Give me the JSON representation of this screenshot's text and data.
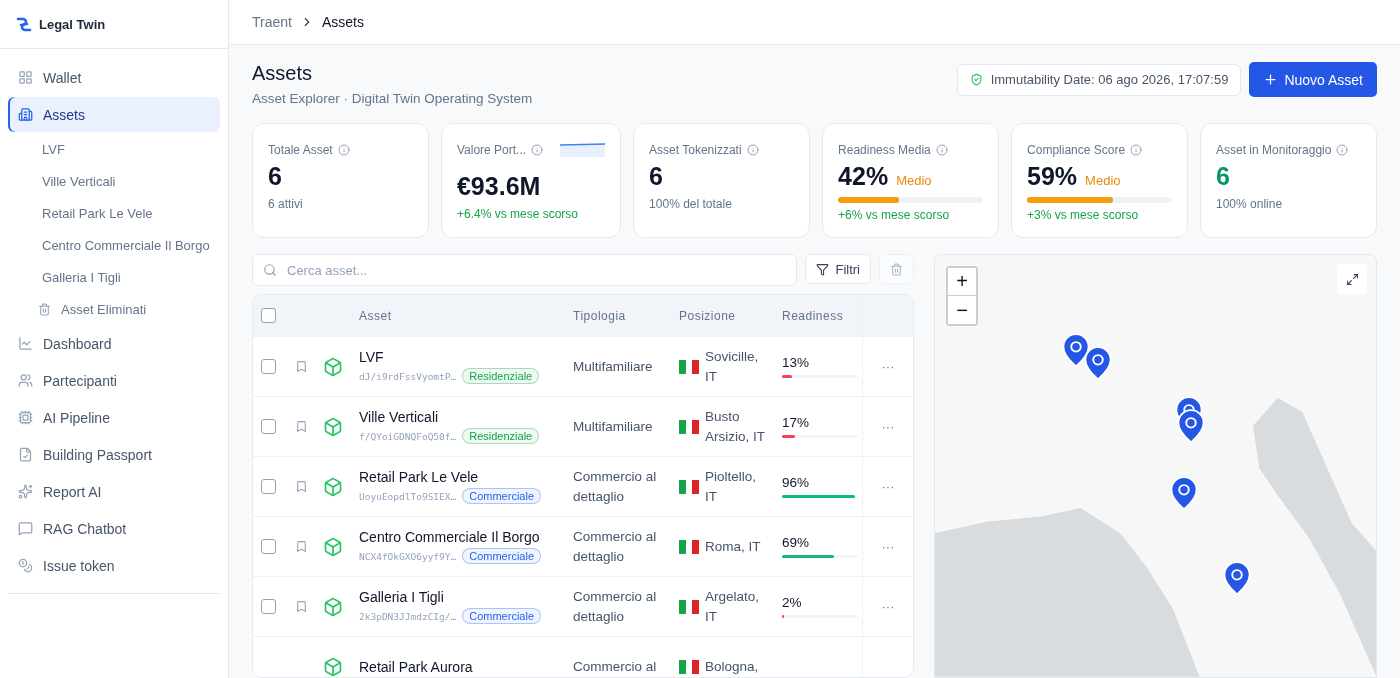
{
  "brand": {
    "name": "Legal Twin"
  },
  "sidebar": {
    "items": [
      {
        "kind": "nav",
        "label": "Wallet",
        "selected": false
      },
      {
        "kind": "nav",
        "label": "Assets",
        "selected": true
      },
      {
        "kind": "sub",
        "label": "LVF",
        "selected": false
      },
      {
        "kind": "sub",
        "label": "Ville Verticali",
        "selected": false
      },
      {
        "kind": "sub",
        "label": "Retail Park Le Vele",
        "selected": false
      },
      {
        "kind": "sub",
        "label": "Centro Commerciale Il Borgo",
        "selected": false
      },
      {
        "kind": "sub",
        "label": "Galleria I Tigli",
        "selected": false
      },
      {
        "kind": "trash",
        "label": "Asset Eliminati",
        "selected": false
      },
      {
        "kind": "nav",
        "label": "Dashboard",
        "selected": false
      },
      {
        "kind": "nav",
        "label": "Partecipanti",
        "selected": false
      },
      {
        "kind": "nav",
        "label": "AI Pipeline",
        "selected": false
      },
      {
        "kind": "nav",
        "label": "Building Passport",
        "selected": false
      },
      {
        "kind": "nav",
        "label": "Report AI",
        "selected": false
      },
      {
        "kind": "nav",
        "label": "RAG Chatbot",
        "selected": false
      },
      {
        "kind": "nav",
        "label": "Issue token",
        "selected": false
      }
    ]
  },
  "breadcrumb": [
    "Traent",
    "Assets"
  ],
  "header": {
    "title": "Assets",
    "subtitle": "Asset Explorer · Digital Twin Operating System",
    "immutability": "Immutability Date: 06 ago 2026, 17:07:59",
    "new_button": "Nuovo Asset"
  },
  "kpis": [
    {
      "kind": "plain",
      "label": "Totale Asset",
      "value": "6",
      "sub": "6 attivi"
    },
    {
      "kind": "spark",
      "label": "Valore Port...",
      "value": "€93.6M",
      "sub": "+6.4% vs mese scorso"
    },
    {
      "kind": "plain",
      "label": "Asset Tokenizzati",
      "value": "6",
      "sub": "100% del totale"
    },
    {
      "kind": "meter",
      "label": "Readiness Media",
      "value": "42%",
      "badge": "Medio",
      "level": 0.42,
      "sub": "+6% vs mese scorso"
    },
    {
      "kind": "meter",
      "label": "Compliance Score",
      "value": "59%",
      "badge": "Medio",
      "level": 0.59,
      "sub": "+3% vs mese scorso"
    },
    {
      "kind": "online",
      "label": "Asset in Monitoraggio",
      "value": "6",
      "sub": "100% online"
    }
  ],
  "search": {
    "placeholder": "Cerca asset..."
  },
  "filter_button": "Filtri",
  "table": {
    "all_checked": false,
    "columns": [
      "Asset",
      "Tipologia",
      "Posizione",
      "Readiness"
    ],
    "rows": [
      {
        "checked": false,
        "bookmarked": false,
        "name": "LVF",
        "hash": "dJ/i9rdFssVyomtP…",
        "tag": "Residenziale",
        "color": "#16a34a",
        "type": "Multifamiliare",
        "location": "Sovicille, IT",
        "readiness": "13%",
        "level": 0.13,
        "action": "···"
      },
      {
        "checked": false,
        "bookmarked": false,
        "name": "Ville Verticali",
        "hash": "f/QYoiGDNQFoQ50f…",
        "tag": "Residenziale",
        "color": "#16a34a",
        "type": "Multifamiliare",
        "location": "Busto Arsizio, IT",
        "readiness": "17%",
        "level": 0.17,
        "action": "···"
      },
      {
        "checked": false,
        "bookmarked": false,
        "name": "Retail Park Le Vele",
        "hash": "UoyuEopdlTo9SIEX…",
        "tag": "Commerciale",
        "color": "#2563eb",
        "type": "Commercio al dettaglio",
        "location": "Pioltello, IT",
        "readiness": "96%",
        "level": 0.96,
        "action": "···"
      },
      {
        "checked": false,
        "bookmarked": false,
        "name": "Centro Commerciale Il Borgo",
        "hash": "NCX4fOkGXO6yyf9Y…",
        "tag": "Commerciale",
        "color": "#2563eb",
        "type": "Commercio al dettaglio",
        "location": "Roma, IT",
        "readiness": "69%",
        "level": 0.69,
        "action": "···"
      },
      {
        "checked": false,
        "bookmarked": false,
        "name": "Galleria I Tigli",
        "hash": "2k3pDN3JJmdzCIg/…",
        "tag": "Commerciale",
        "color": "#2563eb",
        "type": "Commercio al dettaglio",
        "location": "Argelato, IT",
        "readiness": "2%",
        "level": 0.02,
        "action": "···"
      },
      {
        "name": "Retail Park Aurora",
        "type": "Commercio al",
        "location": "Bologna,"
      }
    ]
  },
  "map": {
    "zoom_in": "+",
    "zoom_out": "−"
  }
}
